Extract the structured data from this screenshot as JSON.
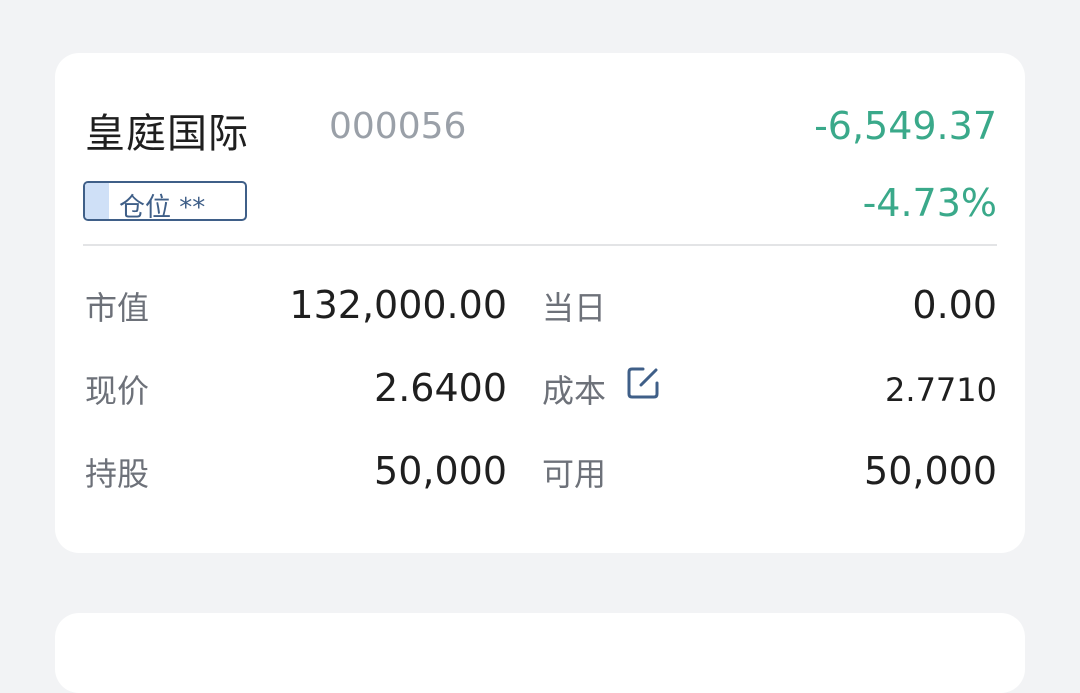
{
  "stock": {
    "name": "皇庭国际",
    "code": "000056",
    "pnl_amount": "-6,549.37",
    "pnl_percent": "-4.73%",
    "position_label": "仓位 **",
    "position_fraction": 0.15
  },
  "metrics": {
    "market_value_label": "市值",
    "market_value": "132,000.00",
    "today_label": "当日",
    "today_value": "0.00",
    "price_label": "现价",
    "price_value": "2.6400",
    "cost_label": "成本",
    "cost_value": "2.7710",
    "holding_label": "持股",
    "holding_value": "50,000",
    "available_label": "可用",
    "available_value": "50,000"
  },
  "colors": {
    "loss": "#3aa98a",
    "badge": "#3f5f88",
    "badge_fill": "#cfe0f7"
  },
  "icons": {
    "cost_edit": "edit-icon"
  }
}
